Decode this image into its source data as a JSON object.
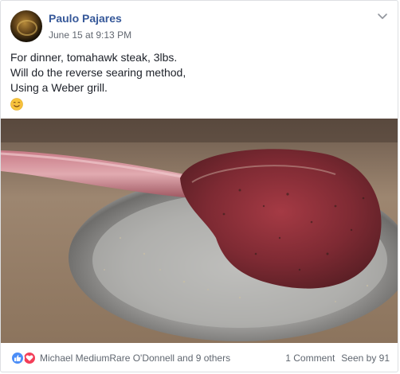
{
  "post": {
    "author": "Paulo Pajares",
    "timestamp": "June 15 at 9:13 PM",
    "text_lines": [
      "For dinner, tomahawk steak, 3lbs.",
      "Will do the reverse searing method,",
      "Using a Weber grill."
    ]
  },
  "footer": {
    "reaction_names": "Michael MediumRare O'Donnell and 9 others",
    "comments": "1 Comment",
    "seen": "Seen by 91"
  },
  "icons": {
    "chevron": "chevron-down-icon",
    "emoji": "smiling-face-icon",
    "like": "thumbs-up-icon",
    "love": "heart-icon"
  },
  "colors": {
    "author": "#365899",
    "like": "#4c8ef7",
    "love": "#f33e58",
    "meta": "#616770"
  }
}
